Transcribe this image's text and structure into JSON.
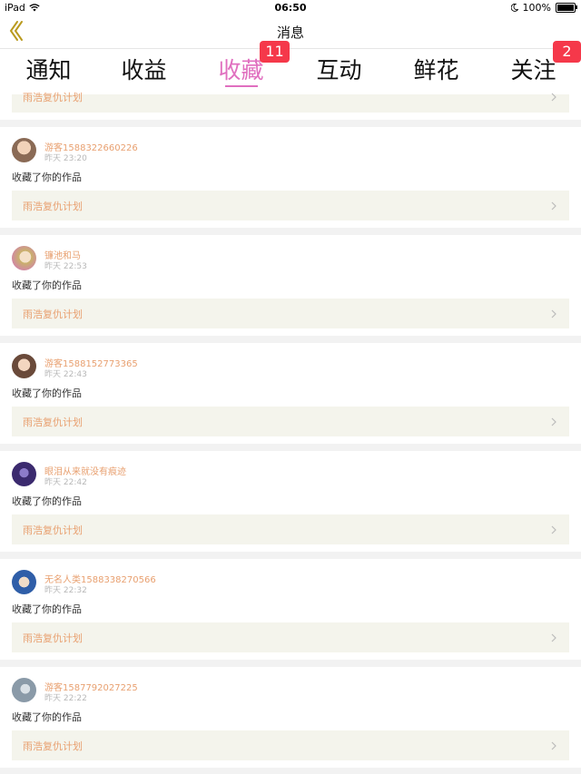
{
  "status_bar": {
    "device": "iPad",
    "time": "06:50",
    "battery": "100%"
  },
  "nav": {
    "title": "消息"
  },
  "tabs": [
    {
      "label": "通知",
      "badge": null
    },
    {
      "label": "收益",
      "badge": null
    },
    {
      "label": "收藏",
      "badge": "11",
      "active": true
    },
    {
      "label": "互动",
      "badge": null
    },
    {
      "label": "鲜花",
      "badge": null
    },
    {
      "label": "关注",
      "badge": "2"
    }
  ],
  "partial_item": {
    "work": "雨浩复仇计划"
  },
  "items": [
    {
      "user": "游客1588322660226",
      "time": "昨天 23:20",
      "action": "收藏了你的作品",
      "work": "雨浩复仇计划",
      "avatar_color": "#8a6a55"
    },
    {
      "user": "镰池和马",
      "time": "昨天 22:53",
      "action": "收藏了你的作品",
      "work": "雨浩复仇计划",
      "avatar_color": "#c9b26a"
    },
    {
      "user": "游客1588152773365",
      "time": "昨天 22:43",
      "action": "收藏了你的作品",
      "work": "雨浩复仇计划",
      "avatar_color": "#6a4a3a"
    },
    {
      "user": "眼泪从来就没有痕迹",
      "time": "昨天 22:42",
      "action": "收藏了你的作品",
      "work": "雨浩复仇计划",
      "avatar_color": "#3b2a6e"
    },
    {
      "user": "无名人类1588338270566",
      "time": "昨天 22:32",
      "action": "收藏了你的作品",
      "work": "雨浩复仇计划",
      "avatar_color": "#2f5ea8"
    },
    {
      "user": "游客1587792027225",
      "time": "昨天 22:22",
      "action": "收藏了你的作品",
      "work": "雨浩复仇计划",
      "avatar_color": "#8a9aa8"
    }
  ]
}
